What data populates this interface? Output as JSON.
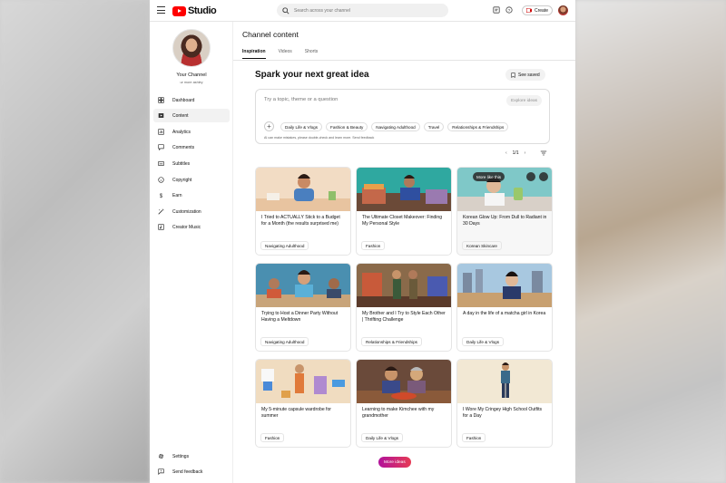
{
  "app": {
    "logo_text": "Studio"
  },
  "header": {
    "search_placeholder": "Search across your channel",
    "create_label": "Create"
  },
  "sidebar": {
    "channel_name": "Your Channel",
    "channel_handle": "ur more ashley",
    "items": [
      {
        "label": "Dashboard",
        "icon": "dashboard-icon"
      },
      {
        "label": "Content",
        "icon": "content-icon",
        "active": true
      },
      {
        "label": "Analytics",
        "icon": "analytics-icon"
      },
      {
        "label": "Comments",
        "icon": "comments-icon"
      },
      {
        "label": "Subtitles",
        "icon": "subtitles-icon"
      },
      {
        "label": "Copyright",
        "icon": "copyright-icon"
      },
      {
        "label": "Earn",
        "icon": "earn-icon"
      },
      {
        "label": "Customization",
        "icon": "customization-icon"
      },
      {
        "label": "Creator Music",
        "icon": "music-icon"
      }
    ],
    "bottom": [
      {
        "label": "Settings",
        "icon": "gear-icon"
      },
      {
        "label": "Send feedback",
        "icon": "feedback-icon"
      }
    ]
  },
  "main": {
    "page_title": "Channel content",
    "tabs": [
      {
        "label": "Inspiration",
        "active": true
      },
      {
        "label": "Videos"
      },
      {
        "label": "Shorts"
      }
    ],
    "heading": "Spark your next great idea",
    "see_saved_label": "See saved",
    "idea_box": {
      "placeholder": "Try a topic, theme or a question",
      "explore_label": "Explore ideas",
      "chips": [
        "Daily Life & Vlogs",
        "Fashion & Beauty",
        "Navigating Adulthood",
        "Travel",
        "Relationships & Friendships"
      ],
      "disclaimer": "AI can make mistakes, please double-check and learn more. Send feedback"
    },
    "pager": "1/1",
    "hover_label": "More like this",
    "cards": [
      {
        "title": "I Tried to ACTUALLY Stick to a Budget for a Month (the results surprised me)",
        "tag": "Navigating Adulthood"
      },
      {
        "title": "The Ultimate Closet Makeover: Finding My Personal Style",
        "tag": "Fashion"
      },
      {
        "title": "Korean Glow Up: From Dull to Radiant in 30 Days",
        "tag": "Korean Skincare"
      },
      {
        "title": "Trying to Host a Dinner Party Without Having a Meltdown",
        "tag": "Navigating Adulthood"
      },
      {
        "title": "My Brother and I Try to Style Each Other | Thrifting Challenge",
        "tag": "Relationships & Friendships"
      },
      {
        "title": "A day in the life of a matcha girl in Korea",
        "tag": "Daily Life & Vlogs"
      },
      {
        "title": "My 5-minute capsule wardrobe for summer",
        "tag": "Fashion"
      },
      {
        "title": "Learning to make Kimchee with my grandmother",
        "tag": "Daily Life & Vlogs"
      },
      {
        "title": "I Wore My Cringey High School Outfits for a Day",
        "tag": "Fashion"
      }
    ],
    "more_ideas_label": "More ideas"
  }
}
